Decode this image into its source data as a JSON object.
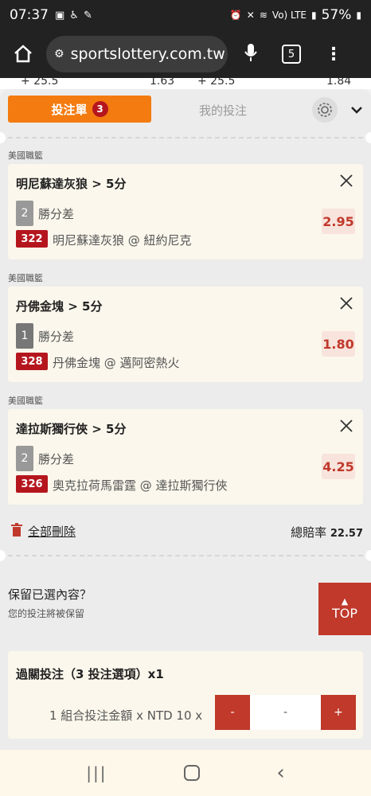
{
  "status": {
    "time": "07:37",
    "left_icons": [
      "gallery-icon",
      "accessibility-icon",
      "wrench-icon"
    ],
    "right_text": "Vo) LTE",
    "battery": "57%"
  },
  "browser": {
    "url": "sportslottery.com.tw",
    "tab_count": "5"
  },
  "peek": {
    "left": "+ 25.5",
    "left_val": "1.63",
    "right": "+ 25.5",
    "right_val": "1.84"
  },
  "tabs": {
    "active_label": "投注單",
    "badge": "3",
    "mine_label": "我的投注"
  },
  "bets": [
    {
      "league": "美國職籃",
      "title": "明尼蘇達灰狼 > 5分",
      "num": "2",
      "bettype": "勝分差",
      "code": "322",
      "match": "明尼蘇達灰狼 @ 紐約尼克",
      "odds": "2.95"
    },
    {
      "league": "美國職籃",
      "title": "丹佛金塊 > 5分",
      "num": "1",
      "bettype": "勝分差",
      "code": "328",
      "match": "丹佛金塊 @ 邁阿密熱火",
      "odds": "1.80"
    },
    {
      "league": "美國職籃",
      "title": "達拉斯獨行俠 > 5分",
      "num": "2",
      "bettype": "勝分差",
      "code": "326",
      "match": "奧克拉荷馬雷霆 @ 達拉斯獨行俠",
      "odds": "4.25"
    }
  ],
  "summary": {
    "delete_all": "全部刪除",
    "total_label": "總賠率",
    "total_value": "22.57"
  },
  "keep": {
    "question": "保留已選內容？",
    "sub": "您的投注將被保留"
  },
  "top_button": "TOP",
  "parlay": {
    "title": "過關投注（3 投注選項）x1",
    "amount_label": "1 組合投注金額 x NTD 10 x",
    "minus": "-",
    "value": "-",
    "plus": "+"
  },
  "colors": {
    "accent_orange": "#f47b10",
    "accent_red": "#c0392b",
    "code_red": "#b5161e",
    "card_bg": "#fbf7ec"
  }
}
